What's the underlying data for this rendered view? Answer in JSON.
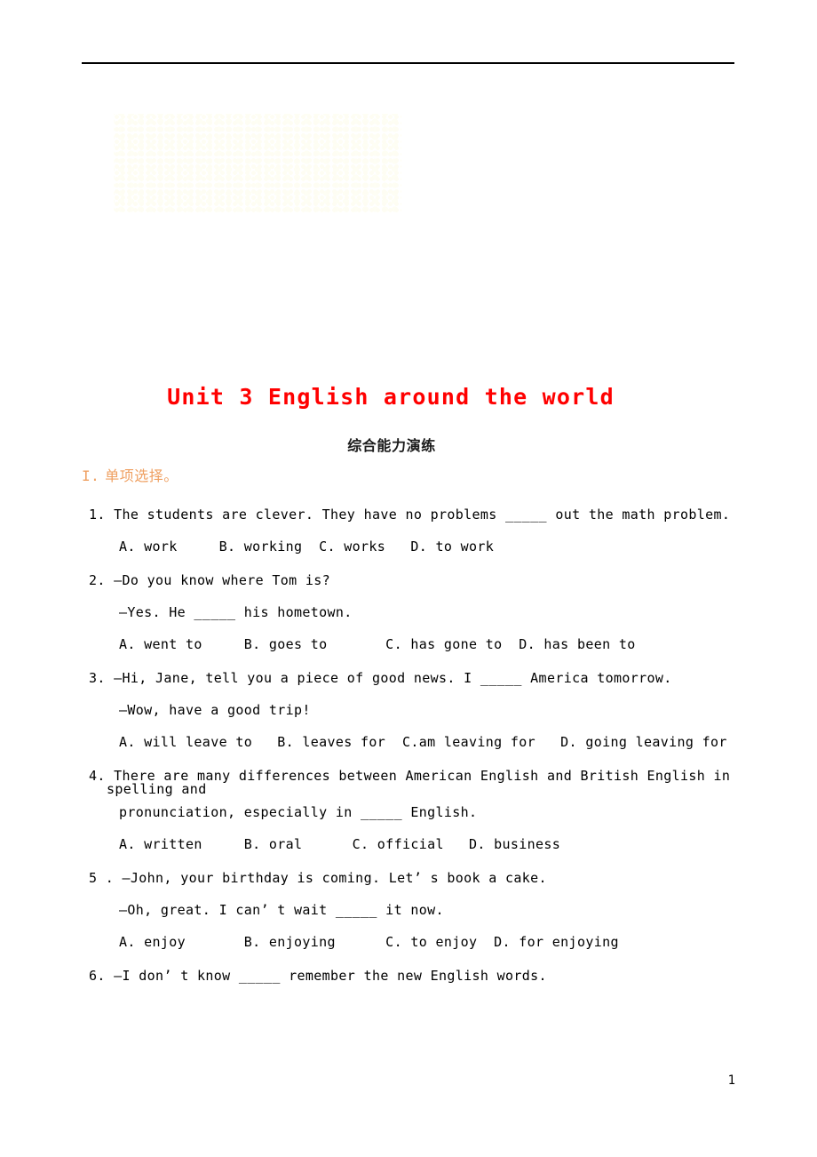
{
  "document": {
    "title": "Unit 3 English around the world",
    "subtitle": "综合能力演练",
    "page_number": "1",
    "colors": {
      "title": "#ff0000",
      "section_header": "#efa062",
      "body_text": "#000000",
      "watermark": "#fdfcdc"
    }
  },
  "sections": [
    {
      "number": "I.",
      "label": "单项选择。"
    }
  ],
  "questions": [
    {
      "number": "1.",
      "stem": "1.  The students are clever. They have no problems _____ out the math problem.",
      "options": "A. work     B. working  C. works   D. to work"
    },
    {
      "number": "2.",
      "stem": "2.  —Do you know where Tom is?",
      "reply": "—Yes. He _____ his hometown.",
      "options": "A. went to     B. goes to       C. has gone to  D. has been to"
    },
    {
      "number": "3.",
      "stem": "3.  —Hi, Jane, tell you a piece of good news. I _____ America tomorrow.",
      "reply": "—Wow, have a good trip!",
      "options": "A. will leave to   B. leaves for  C.am leaving for   D. going leaving for"
    },
    {
      "number": "4.",
      "stem": "4. There are many differences between American English and British English in spelling and",
      "stem_cont": "pronunciation, especially in _____ English.",
      "options": "A. written     B. oral      C. official   D. business"
    },
    {
      "number": "5.",
      "stem": "5 . —John, your birthday is coming. Let’ s book a cake.",
      "reply": "—Oh, great. I can’ t wait _____ it now.",
      "options": "A. enjoy       B. enjoying      C. to enjoy  D. for enjoying"
    },
    {
      "number": "6.",
      "stem": "6.  —I don’ t know _____ remember the new English words."
    }
  ]
}
